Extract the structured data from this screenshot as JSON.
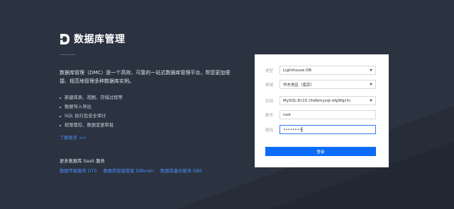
{
  "brand": {
    "title": "数据库管理"
  },
  "intro": {
    "text": "数据库管理（DMC）是一个高效、可靠的一站式数据库管理平台，帮您更加便捷、规范地管理多种数据库实例。"
  },
  "features": [
    "新建库表、视图、存储过程等",
    "数据导入导出",
    "SQL 执行及安全审计",
    "权限管控、数据变更审批"
  ],
  "learn_more": "了解更多 >>",
  "more_services": {
    "title": "更多数据库 SaaS 服务",
    "links": [
      "数据传输服务 DTS",
      "数据库智能管家 DBbrain",
      "数据库备份服务 DBS"
    ]
  },
  "login_form": {
    "type_label": "类型",
    "type_value": "Lighthouse DB",
    "region_label": "地域",
    "region_value": "华东地区（南京）",
    "instance_label": "实例",
    "instance_value": "MySQL-Ec1S (lhdbmysql-ofg9fgch)",
    "account_label": "账号",
    "account_value": "root",
    "password_label": "密码",
    "password_value": "••••••••",
    "submit_label": "登录"
  },
  "colors": {
    "background": "#2b3240",
    "accent": "#0a6cf7",
    "link": "#4b8ef5"
  }
}
